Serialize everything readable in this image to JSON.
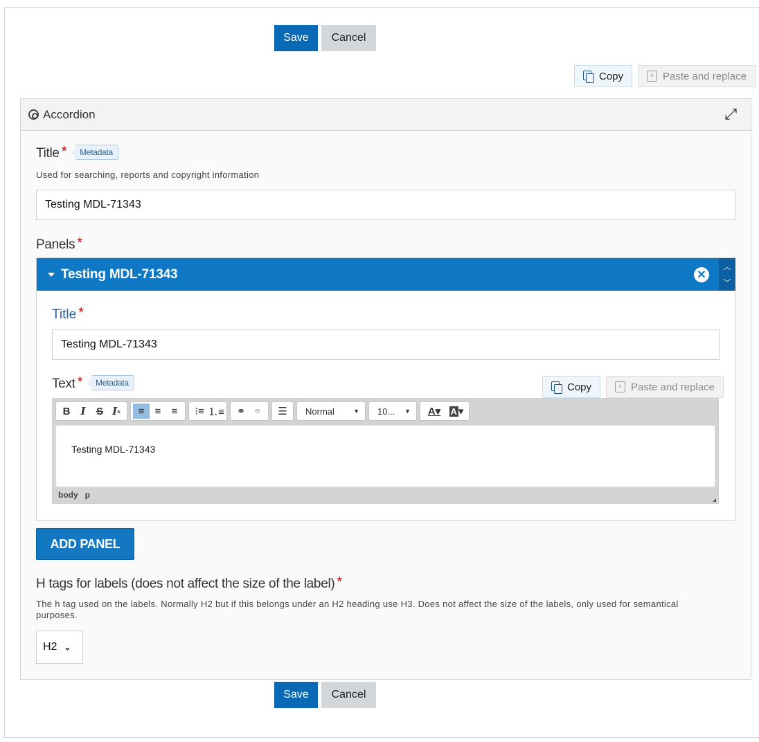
{
  "actions": {
    "save_label": "Save",
    "cancel_label": "Cancel"
  },
  "clipboard": {
    "copy_label": "Copy",
    "paste_label": "Paste and replace"
  },
  "library": {
    "title": "Accordion",
    "title_field": {
      "label": "Title",
      "metadata_tag": "Metadata",
      "description": "Used for searching, reports and copyright information",
      "value": "Testing MDL-71343"
    },
    "panels": {
      "label": "Panels",
      "items": [
        {
          "header": "Testing MDL-71343",
          "title_label": "Title",
          "title_value": "Testing MDL-71343",
          "text_label": "Text",
          "text_metadata_tag": "Metadata",
          "editor": {
            "format_value": "Normal",
            "size_value": "10...",
            "content": "Testing MDL-71343",
            "path": [
              "body",
              "p"
            ]
          }
        }
      ],
      "add_label": "ADD PANEL"
    },
    "htag": {
      "label": "H tags for labels (does not affect the size of the label)",
      "description": "The h tag used on the labels. Normally H2 but if this belongs under an H2 heading use H3. Does not affect the size of the labels, only used for semantical purposes.",
      "value": "H2"
    }
  },
  "colors": {
    "primary": "#0a69b4",
    "panel_header": "#0f78c4",
    "required": "#cc0000"
  }
}
